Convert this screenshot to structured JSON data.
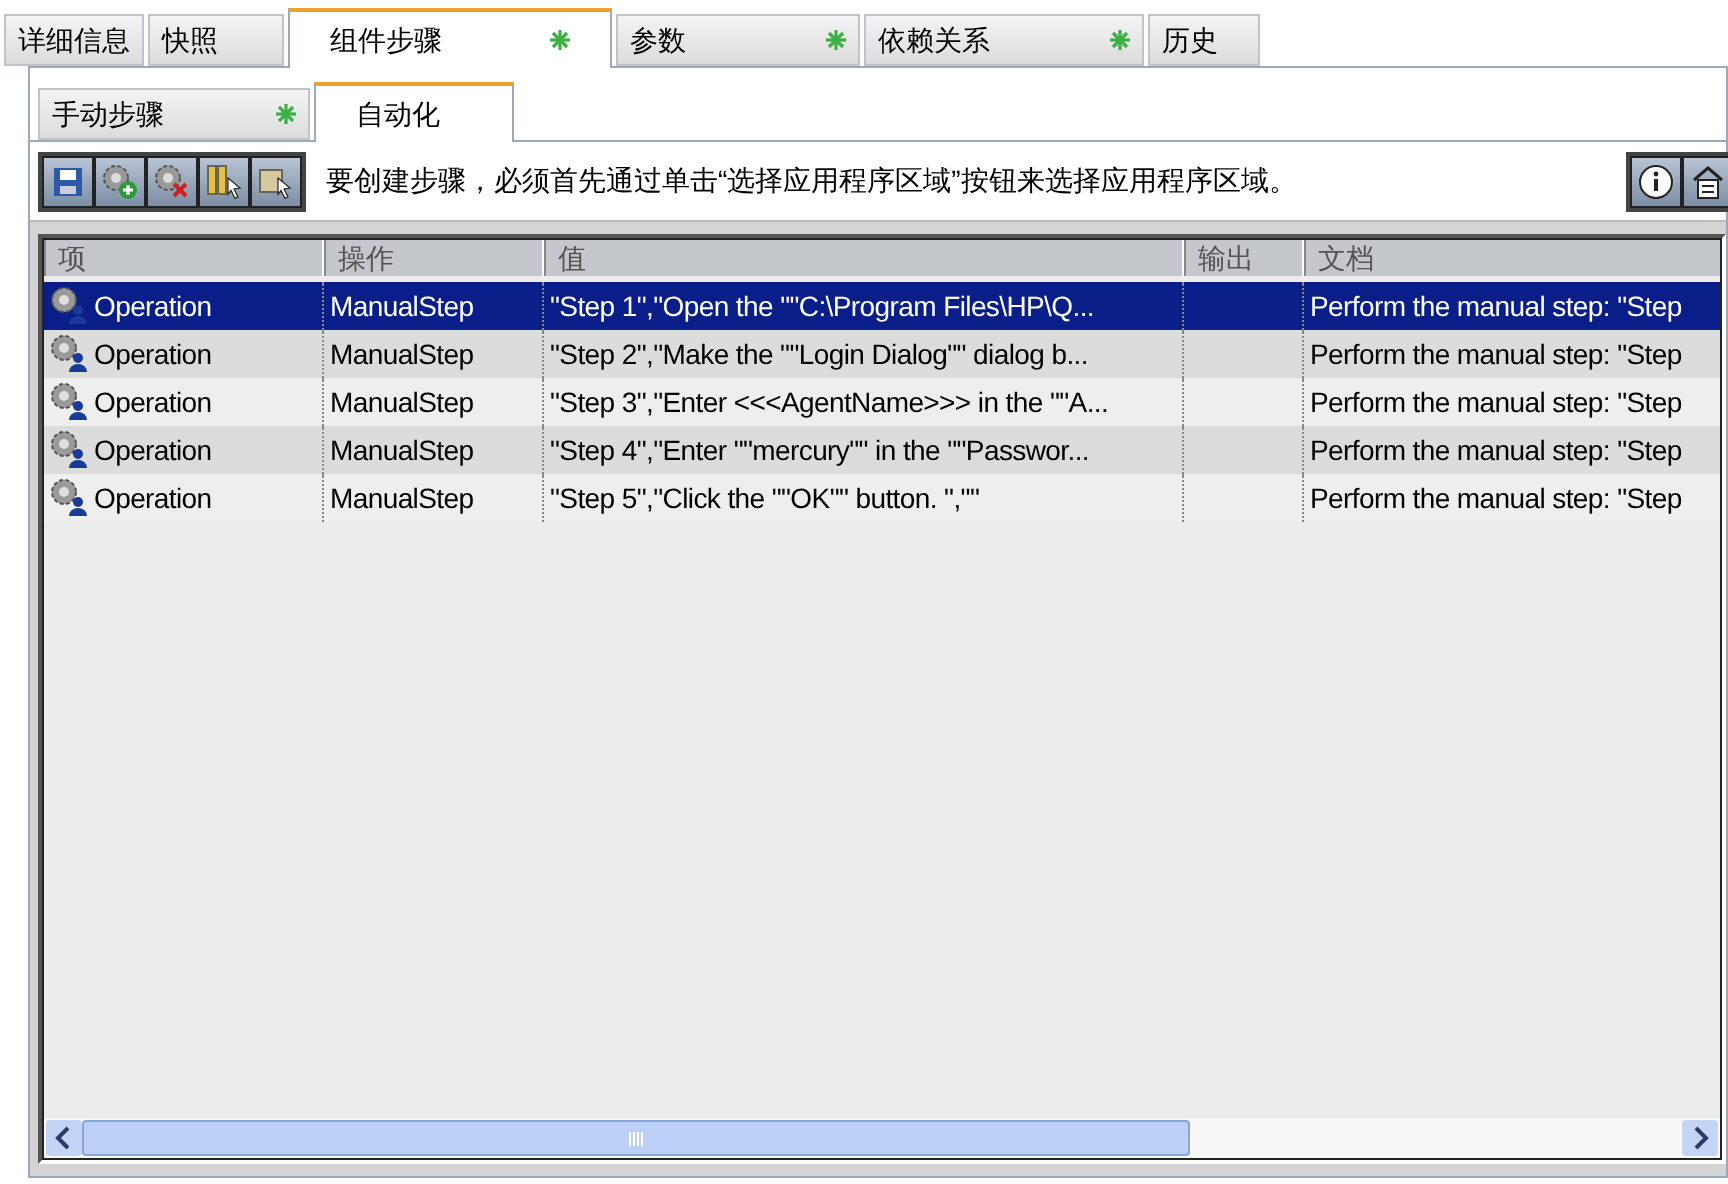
{
  "tabs": [
    {
      "label": "详细信息",
      "selected": false,
      "modified": false
    },
    {
      "label": "快照",
      "selected": false,
      "modified": false
    },
    {
      "label": "组件步骤",
      "selected": true,
      "modified": true
    },
    {
      "label": "参数",
      "selected": false,
      "modified": true
    },
    {
      "label": "依赖关系",
      "selected": false,
      "modified": true
    },
    {
      "label": "历史",
      "selected": false,
      "modified": false
    }
  ],
  "subtabs": [
    {
      "label": "手动步骤",
      "selected": false,
      "modified": true
    },
    {
      "label": "自动化",
      "selected": true,
      "modified": false
    }
  ],
  "toolbar": {
    "message": "要创建步骤，必须首先通过单击“选择应用程序区域”按钮来选择应用程序区域。"
  },
  "table": {
    "columns": [
      "项",
      "操作",
      "值",
      "输出",
      "文档"
    ],
    "rows": [
      {
        "selected": true,
        "cells": [
          "Operation",
          "ManualStep",
          "\"Step 1\",\"Open the \"\"C:\\Program Files\\HP\\Q...",
          "",
          "Perform the manual step: \"Step"
        ]
      },
      {
        "selected": false,
        "cells": [
          "Operation",
          "ManualStep",
          "\"Step 2\",\"Make the \"\"Login Dialog\"\" dialog b...",
          "",
          "Perform the manual step: \"Step"
        ]
      },
      {
        "selected": false,
        "cells": [
          "Operation",
          "ManualStep",
          "\"Step 3\",\"Enter <<<AgentName>>> in the \"\"A...",
          "",
          "Perform the manual step: \"Step"
        ]
      },
      {
        "selected": false,
        "cells": [
          "Operation",
          "ManualStep",
          "\"Step 4\",\"Enter \"\"mercury\"\" in the \"\"Passwor...",
          "",
          "Perform the manual step: \"Step"
        ]
      },
      {
        "selected": false,
        "cells": [
          "Operation",
          "ManualStep",
          "\"Step 5\",\"Click the \"\"OK\"\" button. \",\"\"",
          "",
          "Perform the manual step: \"Step"
        ]
      }
    ]
  }
}
